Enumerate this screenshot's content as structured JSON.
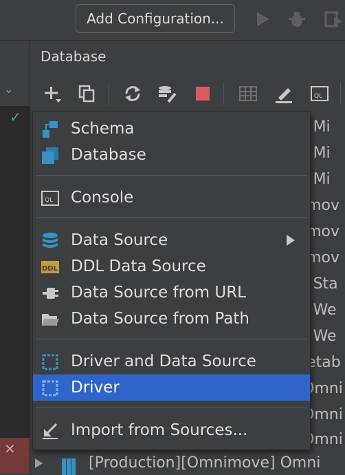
{
  "toolbar": {
    "add_config_label": "Add Configuration..."
  },
  "panel": {
    "title": "Database"
  },
  "menu": {
    "items": [
      {
        "label": "Schema",
        "icon": "schema-icon"
      },
      {
        "label": "Database",
        "icon": "database-icon"
      },
      {
        "label": "Console",
        "icon": "console-icon"
      },
      {
        "label": "Data Source",
        "icon": "datasource-icon",
        "submenu": true
      },
      {
        "label": "DDL Data Source",
        "icon": "ddl-icon"
      },
      {
        "label": "Data Source from URL",
        "icon": "plug-icon"
      },
      {
        "label": "Data Source from Path",
        "icon": "folder-icon"
      },
      {
        "label": "Driver and Data Source",
        "icon": "driver-icon"
      },
      {
        "label": "Driver",
        "icon": "driver-icon",
        "selected": true
      },
      {
        "label": "Import from Sources...",
        "icon": "import-icon"
      }
    ]
  },
  "tree": {
    "rows": [
      "] Mi",
      "] Mi",
      "] Mi",
      "imov",
      "imov",
      "imov",
      "] Sta",
      "] We",
      "] We",
      "letab",
      "Omni",
      "Omni",
      "Omni"
    ],
    "bottom_row": "[Production][Omnimove] Omni"
  },
  "colors": {
    "selection": "#2f65ca",
    "stop": "#db5c5c",
    "check": "#59a869"
  }
}
